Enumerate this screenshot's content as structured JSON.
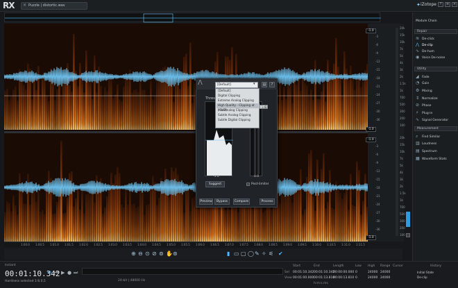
{
  "app": {
    "logo": "RX",
    "tab_label": "Puzzle | distortic.wav",
    "brand": "iZotope",
    "window_buttons": [
      "?",
      "≡",
      "×"
    ]
  },
  "spectrogram": {
    "colors": {
      "background": "#1a0c04",
      "energy": "#e07a1e",
      "waveform": "#6ec6f5"
    }
  },
  "scale": {
    "db_badges": [
      "-1.0",
      "-1.0",
      "-1.0",
      "-1.0"
    ],
    "left_ticks": [
      "-3",
      "-6",
      "-9",
      "-12",
      "-15",
      "-18",
      "-21",
      "-24",
      "-27",
      "-30",
      "-36"
    ],
    "right_ticks": [
      "20k",
      "15k",
      "10k",
      "7k",
      "5k",
      "4k",
      "3k",
      "2k",
      "1.5k",
      "1k",
      "700",
      "500",
      "300",
      "200",
      "100"
    ]
  },
  "timeline": {
    "ticks": [
      "1:00.0",
      "1:00.5",
      "1:01.0",
      "1:01.5",
      "1:02.0",
      "1:02.5",
      "1:03.0",
      "1:03.5",
      "1:04.0",
      "1:04.5",
      "1:05.0",
      "1:05.5",
      "1:06.0",
      "1:06.5",
      "1:07.0",
      "1:07.5",
      "1:08.0",
      "1:08.5",
      "1:09.0",
      "1:09.5",
      "1:10.0",
      "1:10.5",
      "1:11.0",
      "1:11.5"
    ],
    "unit": "h:m:s"
  },
  "dialog": {
    "preset": "[Default]",
    "menu_items": [
      "[Default]",
      "Digital Clipping",
      "Extreme Analog Clipping",
      "High Quality - Clipping at (-1dB)",
      "Mild Analog Clipping",
      "Subtle Analog Clipping",
      "Subtle Digital Clipping"
    ],
    "selected_index": 3,
    "side_label": "-1dB",
    "threshold_label": "Thresh",
    "graph_value": "-1.0",
    "meter_value": "0.0",
    "suggest_label": "Suggest",
    "post_limiter_label": "Post-limiter",
    "post_limiter_checked": true,
    "buttons": {
      "preview": "Preview",
      "bypass": "Bypass",
      "compare": "Compare",
      "process": "Process"
    }
  },
  "panel": {
    "module_chain": "Module Chain",
    "sections": {
      "repair": "Repair",
      "utility": "Utility",
      "measurement": "Measurement"
    },
    "repair_items": [
      "De-click",
      "De-clip",
      "De-hum",
      "Voice De-noise"
    ],
    "utility_items": [
      "Fade",
      "Gain",
      "Mixing",
      "Normalize",
      "Phase",
      "Plug-in",
      "Signal Generator"
    ],
    "measurement_items": [
      "Find Similar",
      "Loudness",
      "Spectrum",
      "Waveform Stats"
    ],
    "active_item": "De-clip"
  },
  "transport": {
    "instant_label": "Instant",
    "timecode": "00:01:10.342",
    "status": "Hardness selected  1:6.0,5",
    "headers": [
      "Start",
      "End",
      "Length",
      "Low",
      "High",
      "Range",
      "Cursor"
    ],
    "sel_label": "Sel",
    "view_label": "View",
    "sel_values": [
      "00:01:10.342",
      "00:01:10.342",
      "00:00:00.000",
      "0",
      "24000",
      "24000",
      ""
    ],
    "view_values": [
      "00:01:00.000",
      "00:01:13.810",
      "00:00:13.810",
      "0",
      "24000",
      "24000",
      ""
    ],
    "hz_label": "h:m:s.ms",
    "bottom_format": "24-bit | 48000 Hz",
    "history_title": "History",
    "history_items": [
      "Initial State",
      "De-clip"
    ]
  }
}
